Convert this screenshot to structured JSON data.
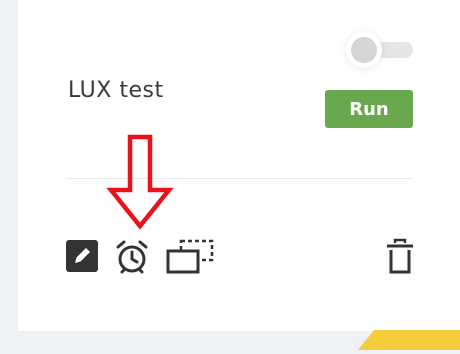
{
  "card": {
    "title": "LUX test",
    "run_label": "Run",
    "toggle_state": "off"
  },
  "actions": {
    "edit_icon": "pencil-icon",
    "schedule_icon": "alarm-clock-icon",
    "duplicate_icon": "copy-icon",
    "delete_icon": "trash-icon"
  },
  "annotation": {
    "arrow_icon": "down-arrow-icon",
    "color": "#e8141a"
  },
  "colors": {
    "run_button": "#6aa84f",
    "accent_corner": "#f5cc3c"
  }
}
